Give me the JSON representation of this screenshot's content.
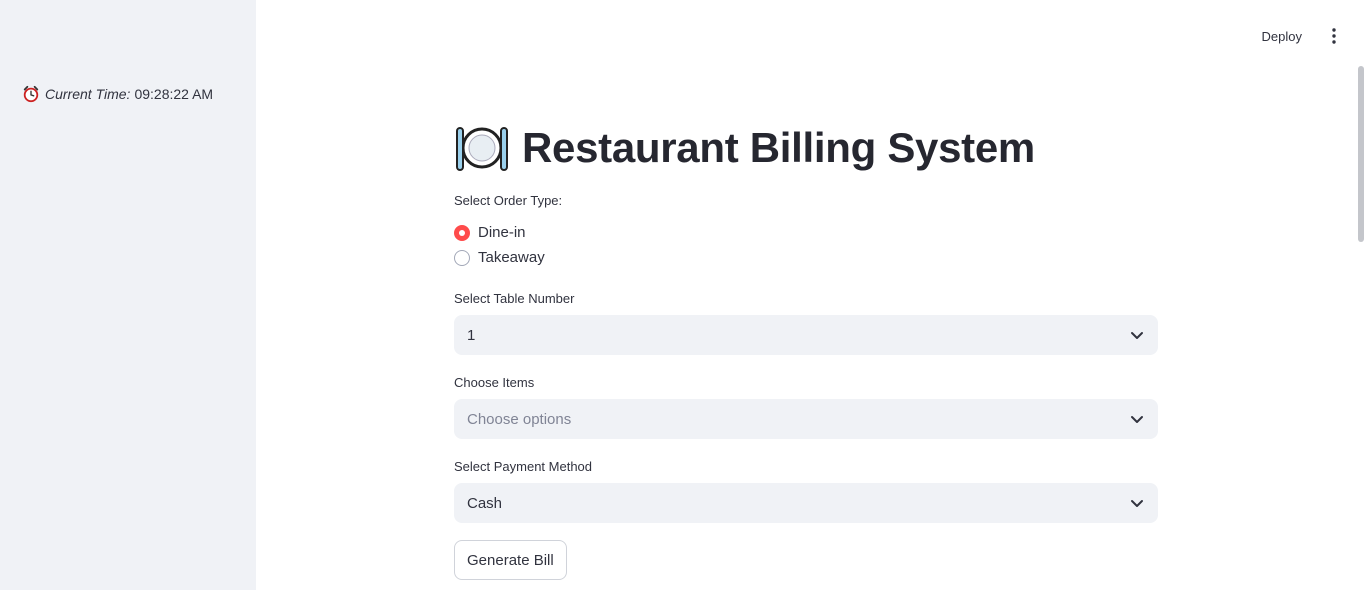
{
  "sidebar": {
    "time_label": "Current Time:",
    "time_value": "09:28:22 AM"
  },
  "header": {
    "deploy_label": "Deploy"
  },
  "main": {
    "title": "Restaurant Billing System",
    "order_type": {
      "label": "Select Order Type:",
      "options": [
        "Dine-in",
        "Takeaway"
      ],
      "selected": "Dine-in"
    },
    "table_number": {
      "label": "Select Table Number",
      "value": "1"
    },
    "items": {
      "label": "Choose Items",
      "placeholder": "Choose options"
    },
    "payment": {
      "label": "Select Payment Method",
      "value": "Cash"
    },
    "generate_label": "Generate Bill"
  },
  "colors": {
    "accent": "#ff4b4b",
    "sidebar_bg": "#f0f2f6",
    "input_bg": "#f0f2f6"
  }
}
